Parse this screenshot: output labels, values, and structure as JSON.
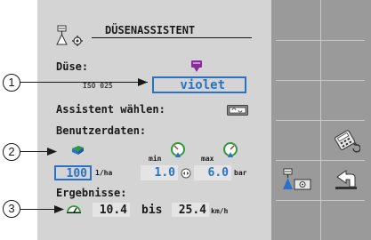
{
  "header": {
    "title": "DÜSENASSISTENT"
  },
  "nozzle": {
    "label": "Düse:",
    "type": "ISO 025",
    "color_name": "violet",
    "color_hex": "#8b2a9c"
  },
  "assistant": {
    "label": "Assistent wählen:"
  },
  "user_data": {
    "label": "Benutzerdaten:",
    "rate_value": "100",
    "rate_unit": "1/ha",
    "min_label": "min",
    "max_label": "max",
    "min_pressure": "1.0",
    "max_pressure": "6.0",
    "pressure_unit": "bar"
  },
  "results": {
    "label": "Ergebnisse:",
    "speed_min": "10.4",
    "bis": "bis",
    "speed_max": "25.4",
    "speed_unit": "km/h"
  },
  "callouts": [
    "1",
    "2",
    "3"
  ],
  "colors": {
    "accent": "#2a73c4",
    "gauge_green": "#2e9a3a",
    "softkey_bg": "#9a9a9a",
    "panel_bg": "#d4d4d4"
  },
  "softkeys": {
    "icons": [
      "calculator-settings-icon",
      "nozzle-settings-icon",
      "return-arrow-icon"
    ]
  }
}
